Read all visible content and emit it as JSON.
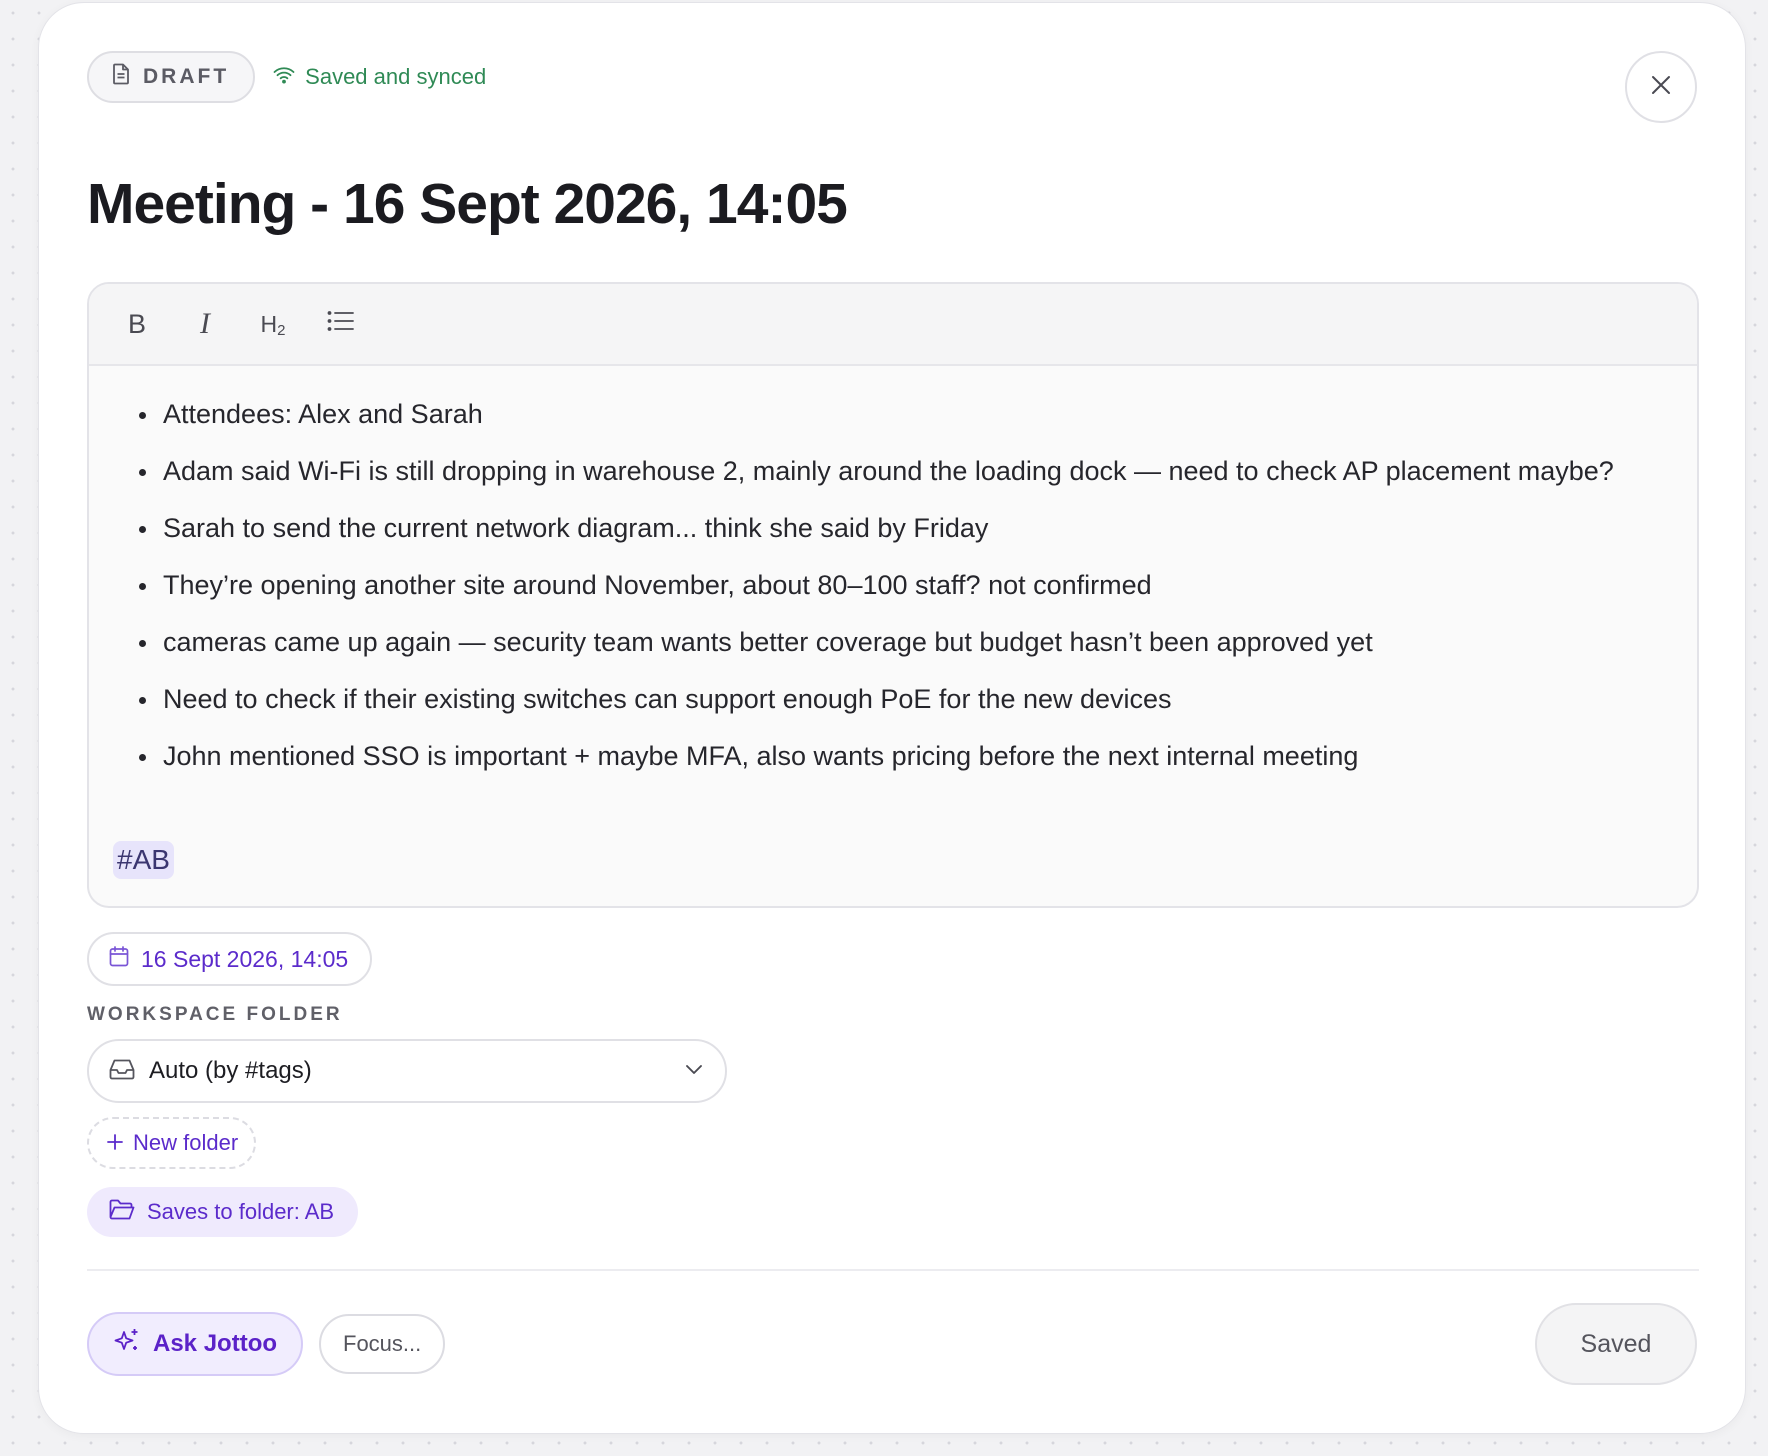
{
  "header": {
    "draft_label": "DRAFT",
    "sync_status": "Saved and synced",
    "sync_color": "#2f8a55"
  },
  "note": {
    "title": "Meeting - 16 Sept 2026, 14:05",
    "items": [
      "Attendees: Alex and Sarah",
      "Adam said Wi-Fi is still dropping in warehouse 2, mainly around the loading dock — need to check AP placement maybe?",
      "Sarah to send the current network diagram... think she said by Friday",
      "They’re opening another site around November, about 80–100 staff? not confirmed",
      "cameras came up again — security team wants better coverage but budget hasn’t been approved yet",
      "Need to check if their existing switches can support enough PoE for the new devices",
      "John mentioned SSO is important + maybe MFA, also wants pricing before the next internal meeting"
    ],
    "tag": "#AB"
  },
  "toolbar": {
    "bold": "B",
    "italic": "I",
    "heading": "H",
    "heading_sub": "2",
    "icons": [
      "bold-icon",
      "italic-icon",
      "heading-2-icon",
      "bullet-list-icon"
    ]
  },
  "meta": {
    "date": "16 Sept 2026, 14:05",
    "folder_label": "WORKSPACE FOLDER",
    "folder_selected": "Auto (by #tags)",
    "new_folder_label": "New folder",
    "saves_to_label": "Saves to folder: AB"
  },
  "footer": {
    "ask_label": "Ask Jottoo",
    "focus_label": "Focus...",
    "saved_label": "Saved"
  },
  "colors": {
    "accent": "#5b2bcb",
    "accent_bg": "#efeafd",
    "tag_bg": "#e7e4fb"
  }
}
